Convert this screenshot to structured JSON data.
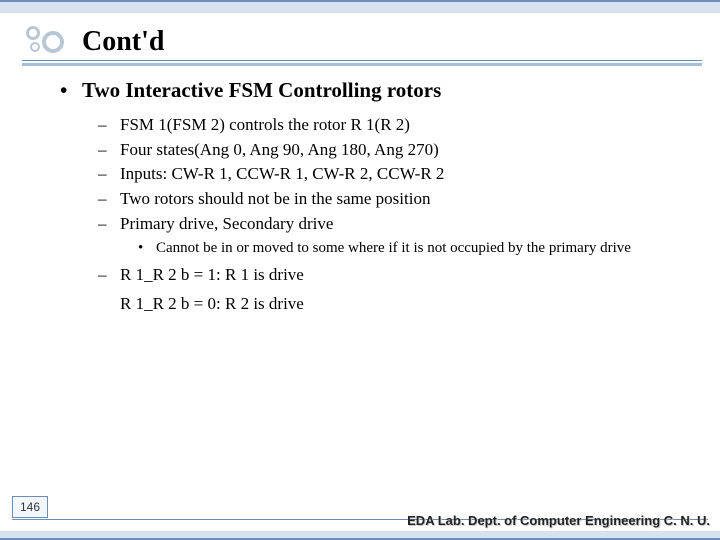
{
  "slide": {
    "title": "Cont'd",
    "page_number": "146",
    "footer": "EDA Lab. Dept. of Computer Engineering C. N. U."
  },
  "content": {
    "heading": "Two Interactive FSM Controlling rotors",
    "items": [
      "FSM 1(FSM 2) controls the rotor R 1(R 2)",
      "Four states(Ang 0, Ang 90, Ang 180, Ang 270)",
      "Inputs: CW-R 1, CCW-R 1, CW-R 2, CCW-R 2",
      "Two rotors should not be in the same position",
      "Primary drive, Secondary drive"
    ],
    "subnote": "Cannot be in or moved to some where if it is not occupied by the primary drive",
    "drive_lines": [
      "R 1_R 2 b = 1: R 1 is drive",
      "R 1_R 2 b = 0: R 2 is drive"
    ]
  }
}
